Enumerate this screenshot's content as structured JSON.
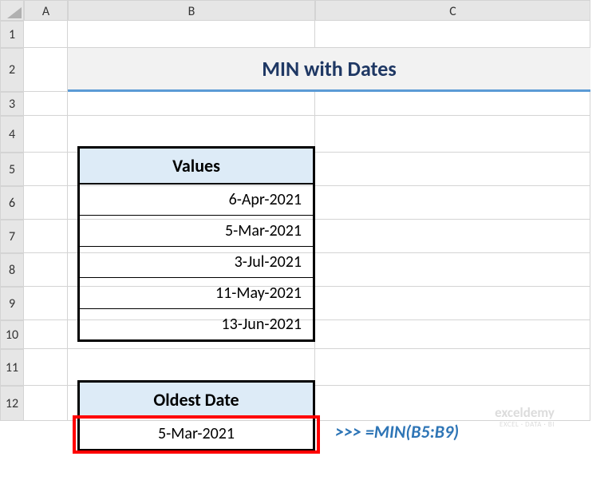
{
  "columns": {
    "a": "A",
    "b": "B",
    "c": "C"
  },
  "rows": [
    "1",
    "2",
    "3",
    "4",
    "5",
    "6",
    "7",
    "8",
    "9",
    "10",
    "11",
    "12"
  ],
  "title": "MIN with Dates",
  "table": {
    "header": "Values",
    "data": [
      "6-Apr-2021",
      "5-Mar-2021",
      "3-Jul-2021",
      "11-May-2021",
      "13-Jun-2021"
    ]
  },
  "result": {
    "header": "Oldest Date",
    "value": "5-Mar-2021"
  },
  "formula": ">>> =MIN(B5:B9)",
  "watermark": {
    "top": "exceldemy",
    "bot": "EXCEL · DATA · BI"
  },
  "chart_data": {
    "type": "table",
    "title": "MIN with Dates",
    "values_header": "Values",
    "values": [
      "6-Apr-2021",
      "5-Mar-2021",
      "3-Jul-2021",
      "11-May-2021",
      "13-Jun-2021"
    ],
    "oldest_date_label": "Oldest Date",
    "oldest_date": "5-Mar-2021",
    "formula": "=MIN(B5:B9)"
  }
}
